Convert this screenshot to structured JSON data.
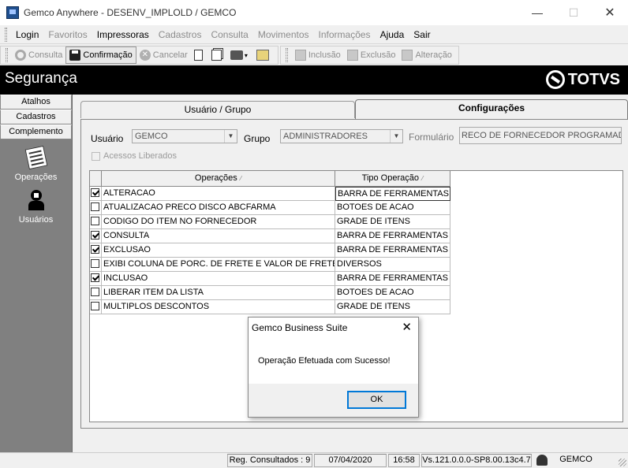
{
  "window": {
    "title": "Gemco Anywhere - DESENV_IMPLOLD / GEMCO",
    "min_glyph": "—",
    "max_glyph": "☐",
    "close_glyph": "✕"
  },
  "menu": {
    "items": [
      {
        "label": "Login",
        "enabled": true
      },
      {
        "label": "Favoritos",
        "enabled": false
      },
      {
        "label": "Impressoras",
        "enabled": true
      },
      {
        "label": "Cadastros",
        "enabled": false
      },
      {
        "label": "Consulta",
        "enabled": false
      },
      {
        "label": "Movimentos",
        "enabled": false
      },
      {
        "label": "Informações",
        "enabled": false
      },
      {
        "label": "Ajuda",
        "enabled": true
      },
      {
        "label": "Sair",
        "enabled": true
      }
    ]
  },
  "toolbar": {
    "consulta": "Consulta",
    "confirmacao": "Confirmação",
    "cancelar": "Cancelar",
    "inclusao": "Inclusão",
    "exclusao": "Exclusão",
    "alteracao": "Alteração",
    "dropdown_caret": "▾",
    "cancel_glyph": "✕"
  },
  "header": {
    "module": "Segurança",
    "brand": "TOTVS"
  },
  "sidebar": {
    "tabs": [
      "Atalhos",
      "Cadastros",
      "Complemento"
    ],
    "entries": [
      "Operações",
      "Usuários"
    ]
  },
  "tabs": [
    "Usuário  / Grupo",
    "Configurações"
  ],
  "form": {
    "usuario_label": "Usuário",
    "usuario_value": "GEMCO",
    "grupo_label": "Grupo",
    "grupo_value": "ADMINISTRADORES",
    "formulario_label": "Formulário",
    "formulario_value": "RECO DE FORNECEDOR PROGRAMADA",
    "acessos_label": "Acessos Liberados",
    "combo_arrow": "▼"
  },
  "grid": {
    "columns": [
      "Operações",
      "Tipo Operação"
    ],
    "sort_glyph": "⁄",
    "rows": [
      {
        "op": "ALTERACAO",
        "tipo": "BARRA DE FERRAMENTAS",
        "checked": true
      },
      {
        "op": "ATUALIZACAO PRECO DISCO ABCFARMA",
        "tipo": "BOTOES DE ACAO",
        "checked": false
      },
      {
        "op": "CODIGO DO ITEM NO FORNECEDOR",
        "tipo": "GRADE DE ITENS",
        "checked": false
      },
      {
        "op": "CONSULTA",
        "tipo": "BARRA DE FERRAMENTAS",
        "checked": true
      },
      {
        "op": "EXCLUSAO",
        "tipo": "BARRA DE FERRAMENTAS",
        "checked": true
      },
      {
        "op": "EXIBI COLUNA DE PORC. DE FRETE E VALOR DE FRETE",
        "tipo": "DIVERSOS",
        "checked": false
      },
      {
        "op": "INCLUSAO",
        "tipo": "BARRA DE FERRAMENTAS",
        "checked": true
      },
      {
        "op": "LIBERAR ITEM DA LISTA",
        "tipo": "BOTOES DE ACAO",
        "checked": false
      },
      {
        "op": "MULTIPLOS DESCONTOS",
        "tipo": "GRADE DE ITENS",
        "checked": false
      }
    ]
  },
  "dialog": {
    "title": "Gemco Business Suite",
    "message": "Operação Efetuada com Sucesso!",
    "ok": "OK",
    "close_glyph": "✕"
  },
  "status": {
    "regs": "Reg. Consultados : 9",
    "date": "07/04/2020",
    "time": "16:58",
    "version": "Vs.121.0.0.0-SP8.00.13c4.7",
    "user": "GEMCO"
  }
}
